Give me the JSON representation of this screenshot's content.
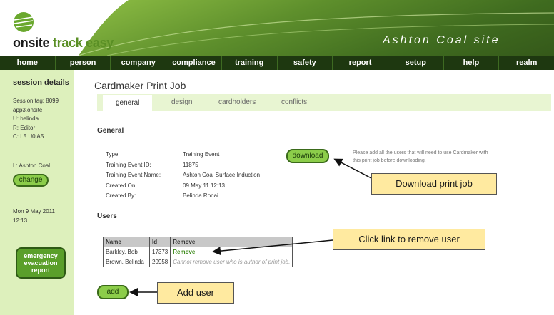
{
  "header": {
    "logo_bold": "onsite",
    "logo_rest": " track easy",
    "site_name": "Ashton Coal site"
  },
  "nav": [
    "home",
    "person",
    "company",
    "compliance",
    "training",
    "safety",
    "report",
    "setup",
    "help",
    "realm"
  ],
  "sidebar": {
    "title": "session details",
    "lines": [
      "Session tag: 8099",
      "app3.onsite",
      "U: belinda",
      "R: Editor",
      "C: L5 U0 A5"
    ],
    "location": "L: Ashton Coal",
    "change_label": "change",
    "date": "Mon 9 May 2011",
    "time": "12:13",
    "emergency_lines": [
      "emergency",
      "evacuation",
      "report"
    ]
  },
  "main": {
    "title": "Cardmaker Print Job",
    "tabs": [
      "general",
      "design",
      "cardholders",
      "conflicts"
    ],
    "general_heading": "General",
    "details": [
      {
        "label": "Type:",
        "value": "Training Event"
      },
      {
        "label": "Training Event ID:",
        "value": "11875"
      },
      {
        "label": "Training Event Name:",
        "value": "Ashton Coal Surface Induction"
      },
      {
        "label": "Created On:",
        "value": "09 May 11 12:13"
      },
      {
        "label": "Created By:",
        "value": "Belinda Ronai"
      }
    ],
    "download_label": "download",
    "hint": "Please add all the users that will need to use Cardmaker with this print job before downloading.",
    "users_heading": "Users",
    "table": {
      "headers": [
        "Name",
        "Id",
        "Remove"
      ],
      "rows": [
        [
          "Barkley, Bob",
          "17373",
          "Remove"
        ],
        [
          "Brown, Belinda",
          "20958",
          "Cannot remove user who is author of print job."
        ]
      ]
    },
    "add_label": "add"
  },
  "callouts": {
    "download": "Download print job",
    "remove": "Click link to remove user",
    "add": "Add user"
  },
  "colors": {
    "nav_bg": "#1e3810",
    "sidebar_bg": "#ddf0bc",
    "button_green": "#8ccd4a",
    "callout_bg": "#ffeaa0"
  }
}
